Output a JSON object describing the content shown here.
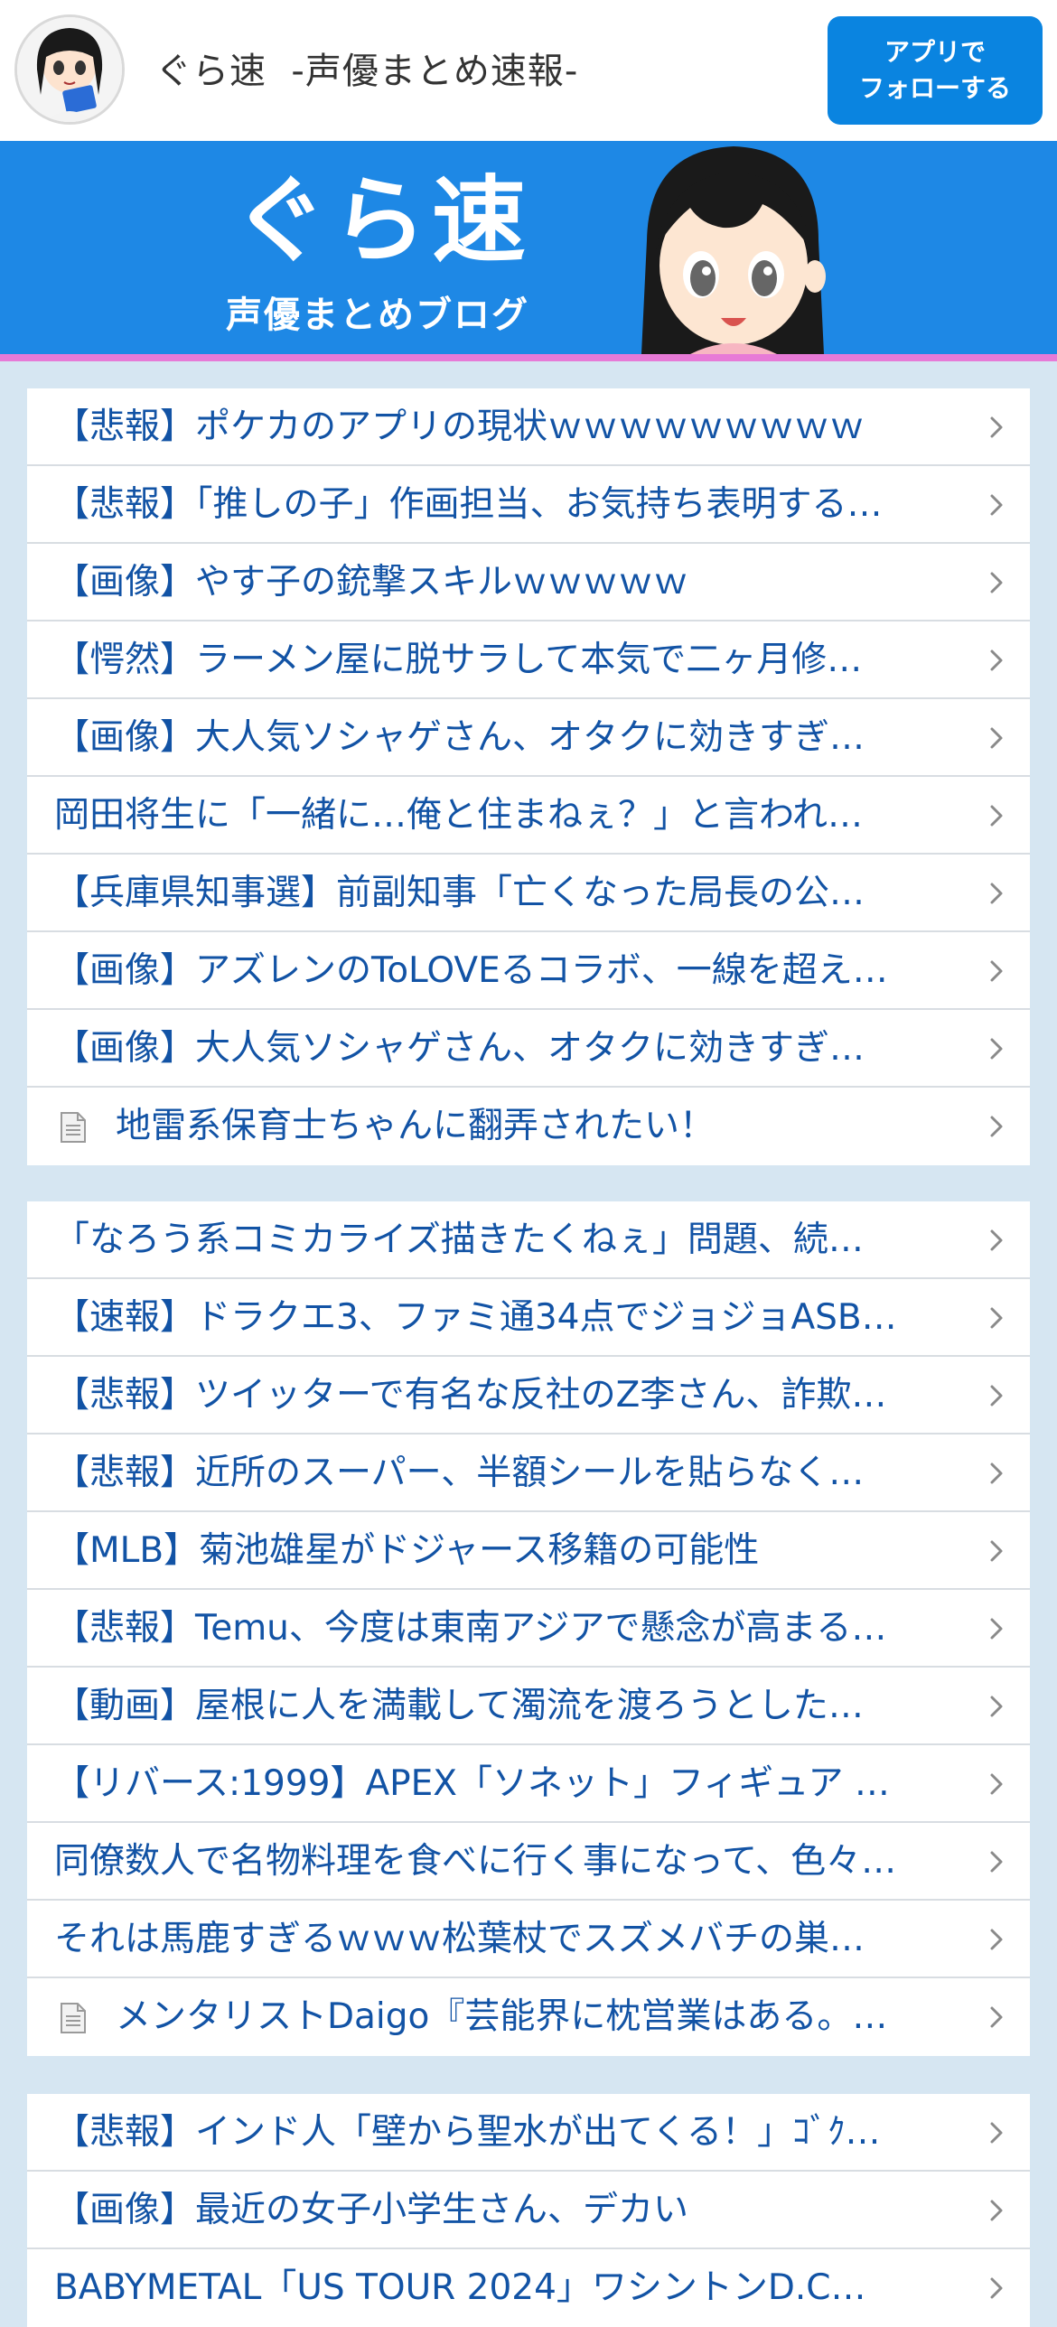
{
  "header": {
    "site_title": "ぐら速  -声優まとめ速報-",
    "follow_line1": "アプリで",
    "follow_line2": "フォローする"
  },
  "banner": {
    "logo_main": "ぐら速",
    "logo_sub": "声優まとめブログ",
    "accent_color": "#1e88e5",
    "underline_color": "#e77ad7"
  },
  "lists": [
    {
      "items": [
        {
          "title": "【悲報】ポケカのアプリの現状ｗｗｗｗｗｗｗｗｗ",
          "icon": "chevron-right-icon"
        },
        {
          "title": "【悲報】「推しの子」作画担当、お気持ち表明する…",
          "icon": "chevron-right-icon"
        },
        {
          "title": "【画像】やす子の銃撃スキルｗｗｗｗｗ",
          "icon": "chevron-right-icon"
        },
        {
          "title": "【愕然】ラーメン屋に脱サラして本気で二ヶ月修…",
          "icon": "chevron-right-icon"
        },
        {
          "title": "【画像】大人気ソシャゲさん、オタクに効きすぎ…",
          "icon": "chevron-right-icon"
        },
        {
          "title": "岡田将生に「一緒に…俺と住まねぇ？」と言われ…",
          "icon": "chevron-right-icon"
        },
        {
          "title": "【兵庫県知事選】前副知事「亡くなった局長の公…",
          "icon": "chevron-right-icon"
        },
        {
          "title": "【画像】アズレンのToLOVEるコラボ、一線を超え…",
          "icon": "chevron-right-icon"
        },
        {
          "title": "【画像】大人気ソシャゲさん、オタクに効きすぎ…",
          "icon": "chevron-right-icon"
        },
        {
          "title": "地雷系保育士ちゃんに翻弄されたい！",
          "icon": "chevron-right-icon",
          "doc": true
        }
      ]
    },
    {
      "items": [
        {
          "title": "「なろう系コミカライズ描きたくねぇ」問題、続…",
          "icon": "chevron-right-icon"
        },
        {
          "title": "【速報】ドラクエ3、ファミ通34点でジョジョASB…",
          "icon": "chevron-right-icon"
        },
        {
          "title": "【悲報】ツイッターで有名な反社のZ李さん、詐欺…",
          "icon": "chevron-right-icon"
        },
        {
          "title": "【悲報】近所のスーパー、半額シールを貼らなく…",
          "icon": "chevron-right-icon"
        },
        {
          "title": "【MLB】菊池雄星がドジャース移籍の可能性",
          "icon": "chevron-right-icon"
        },
        {
          "title": "【悲報】Temu、今度は東南アジアで懸念が高まる…",
          "icon": "chevron-right-icon"
        },
        {
          "title": "【動画】屋根に人を満載して濁流を渡ろうとした…",
          "icon": "chevron-right-icon"
        },
        {
          "title": "【リバース:1999】APEX「ソネット」フィギュア …",
          "icon": "chevron-right-icon"
        },
        {
          "title": "同僚数人で名物料理を食べに行く事になって、色々…",
          "icon": "chevron-right-icon"
        },
        {
          "title": "それは馬鹿すぎるｗｗｗ松葉杖でスズメバチの巣…",
          "icon": "chevron-right-icon"
        },
        {
          "title": "メンタリストDaigo『芸能界に枕営業はある。…",
          "icon": "chevron-right-icon",
          "doc": true
        }
      ]
    },
    {
      "items": [
        {
          "title": "【悲報】インド人「壁から聖水が出てくる！」ｺﾞｸ…",
          "icon": "chevron-right-icon"
        },
        {
          "title": "【画像】最近の女子小学生さん、デカい",
          "icon": "chevron-right-icon"
        },
        {
          "title": "BABYMETAL「US TOUR 2024」ワシントンD.C…",
          "icon": "chevron-right-icon"
        }
      ]
    }
  ]
}
